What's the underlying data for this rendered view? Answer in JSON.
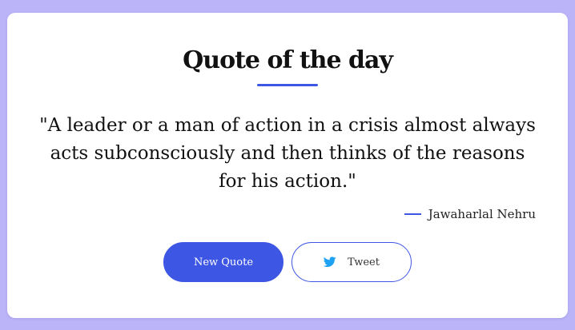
{
  "header": {
    "title": "Quote of the day"
  },
  "quote": {
    "text": "\"A leader or a man of action in a crisis almost always acts subconsciously and then thinks of the reasons for his action.\"",
    "author": "Jawaharlal Nehru"
  },
  "actions": {
    "new_quote_label": "New Quote",
    "tweet_label": "Tweet",
    "tweet_icon": "twitter-icon"
  },
  "colors": {
    "background": "#bcb4f9",
    "accent": "#3d57e4",
    "twitter": "#1da1f2"
  }
}
